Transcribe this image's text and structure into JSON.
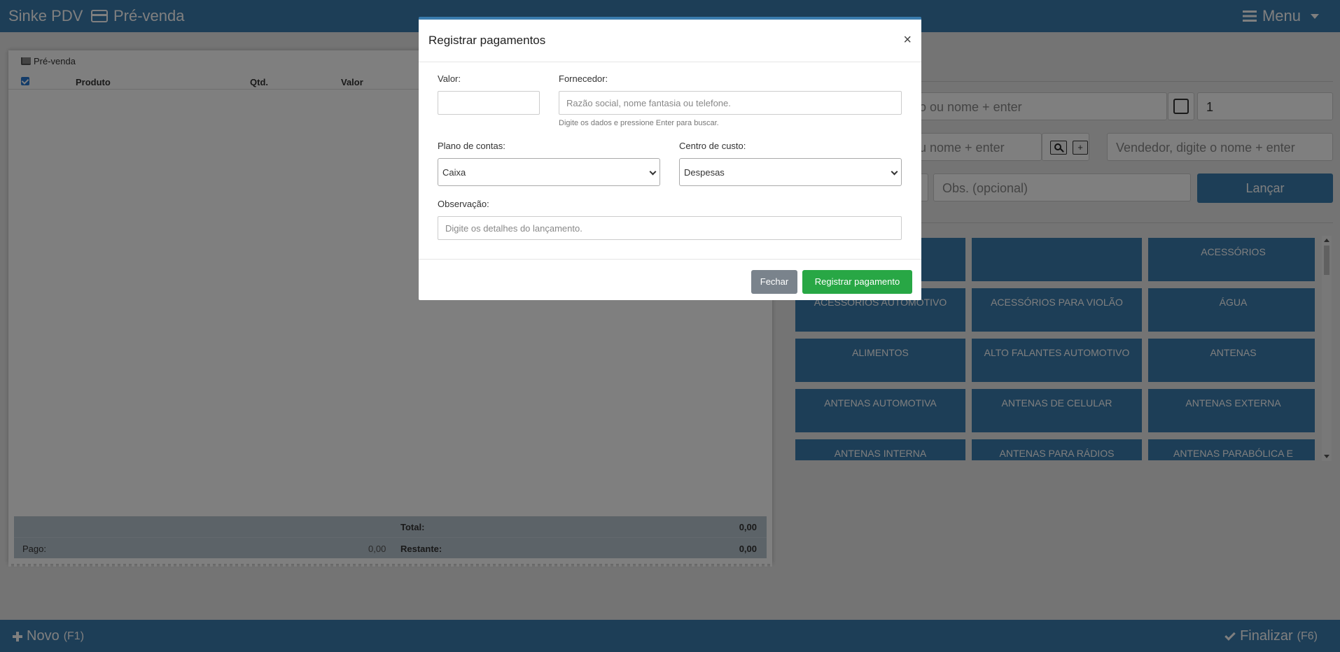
{
  "app": {
    "brand": "Sinke PDV",
    "section": "Pré-venda",
    "menu_label": "Menu"
  },
  "left_panel": {
    "title": "Pré-venda",
    "columns": {
      "product": "Produto",
      "qty": "Qtd.",
      "value": "Valor"
    },
    "totals": {
      "total_label": "Total:",
      "total_value": "0,00",
      "paid_label": "Pago:",
      "paid_value": "0,00",
      "remaining_label": "Restante:",
      "remaining_value": "0,00"
    }
  },
  "right_panel": {
    "product_input_partial": "o ou nome + enter",
    "quantity_value": "1",
    "client_input_partial": "u nome + enter",
    "search_btn": "",
    "add_btn": "+",
    "seller_placeholder": "Vendedor, digite o nome + enter",
    "obs_placeholder": "Obs. (opcional)",
    "launch_label": "Lançar",
    "categories": [
      "",
      "",
      "ACESSÓRIOS",
      "ACESSÓRIOS AUTOMOTIVO",
      "ACESSÓRIOS PARA VIOLÃO",
      "ÁGUA",
      "ALIMENTOS",
      "ALTO FALANTES AUTOMOTIVO",
      "ANTENAS",
      "ANTENAS AUTOMOTIVA",
      "ANTENAS DE CELULAR",
      "ANTENAS EXTERNA",
      "ANTENAS INTERNA",
      "ANTENAS PARA RÁDIOS",
      "ANTENAS PARABÓLICA E"
    ]
  },
  "bottom": {
    "new_label": "Novo",
    "new_shortcut": "(F1)",
    "finish_label": "Finalizar",
    "finish_shortcut": "(F6)"
  },
  "modal": {
    "title": "Registrar pagamentos",
    "close": "×",
    "valor_label": "Valor:",
    "valor_value": "",
    "fornecedor_label": "Fornecedor:",
    "fornecedor_placeholder": "Razão social, nome fantasia ou telefone.",
    "fornecedor_hint": "Digite os dados e pressione Enter para buscar.",
    "plano_label": "Plano de contas:",
    "plano_value": "Caixa",
    "centro_label": "Centro de custo:",
    "centro_value": "Despesas",
    "obs_label": "Observação:",
    "obs_placeholder": "Digite os detalhes do lançamento.",
    "close_button": "Fechar",
    "submit_button": "Registrar pagamento"
  },
  "colors": {
    "primary": "#3a7cae",
    "success": "#28a745",
    "secondary": "#7a838c"
  }
}
